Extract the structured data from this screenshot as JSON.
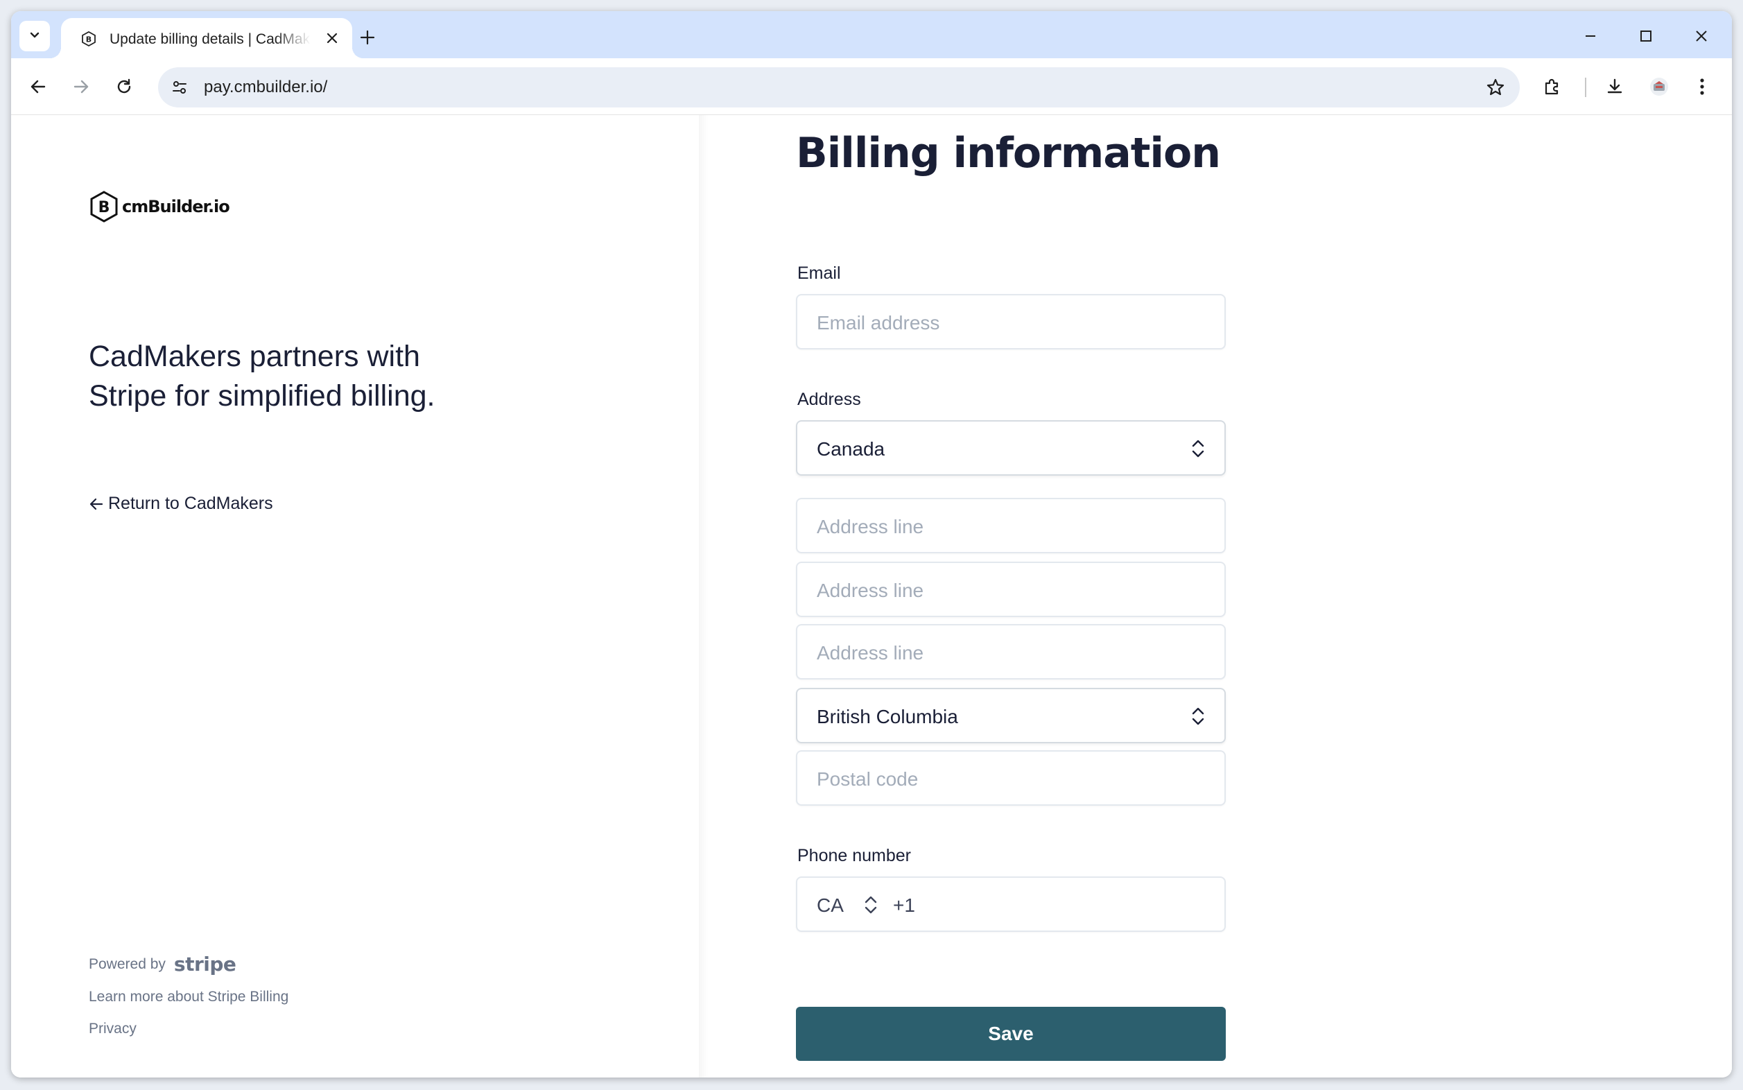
{
  "browser": {
    "tab_title": "Update billing details | CadMakers",
    "url": "pay.cmbuilder.io/"
  },
  "brand": {
    "logo_text": "cmBuilder.io"
  },
  "left": {
    "headline": "CadMakers partners with Stripe for simplified billing.",
    "return_link": "Return to CadMakers",
    "powered_by": "Powered by",
    "stripe_word": "stripe",
    "learn_more": "Learn more about Stripe Billing",
    "privacy": "Privacy"
  },
  "form": {
    "title": "Billing information",
    "email_label": "Email",
    "email_placeholder": "Email address",
    "address_label": "Address",
    "country_value": "Canada",
    "address_line_1_placeholder": "Address line",
    "address_line_2_placeholder": "Address line",
    "address_line_3_placeholder": "Address line",
    "province_value": "British Columbia",
    "postal_placeholder": "Postal code",
    "phone_label": "Phone number",
    "phone_country": "CA",
    "phone_prefix": "+1",
    "save_label": "Save"
  },
  "colors": {
    "save_button": "#2c5f6e",
    "tab_strip": "#d3e3fd",
    "omnibox": "#e9eef6",
    "text_primary": "#1a1f36",
    "text_muted": "#697386"
  },
  "icons": [
    "tab-search-icon",
    "favicon-icon",
    "close-icon",
    "plus-icon",
    "minimize-icon",
    "maximize-icon",
    "window-close-icon",
    "back-arrow-icon",
    "forward-arrow-icon",
    "reload-icon",
    "site-settings-icon",
    "star-icon",
    "extensions-icon",
    "download-icon",
    "profile-icon",
    "menu-icon",
    "arrow-left-icon",
    "chevron-updown-icon"
  ]
}
